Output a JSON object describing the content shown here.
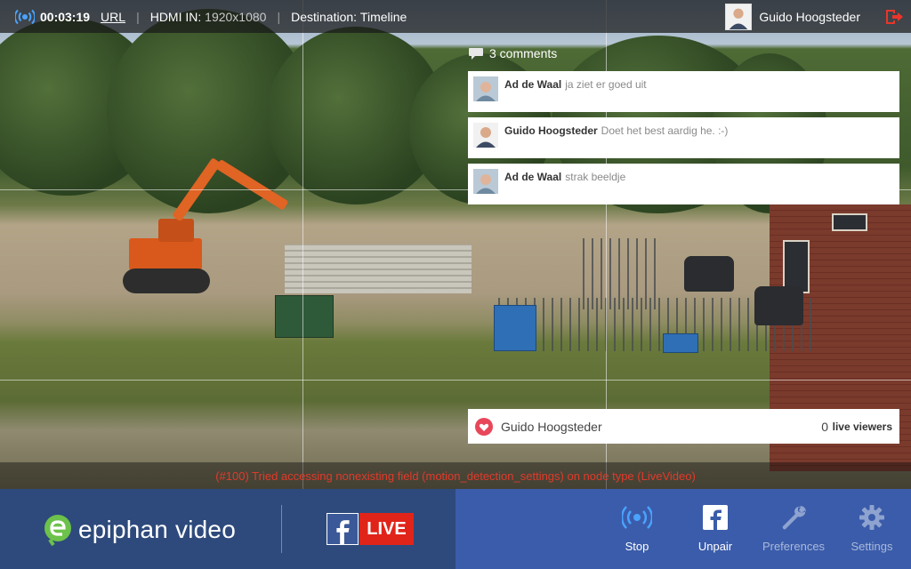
{
  "topbar": {
    "timer": "00:03:19",
    "url_label": "URL",
    "hdmi_label": "HDMI IN:",
    "hdmi_value": "1920x1080",
    "destination_label": "Destination:",
    "destination_value": "Timeline",
    "user_name": "Guido Hoogsteder"
  },
  "comments": {
    "count_label": "3 comments",
    "items": [
      {
        "name": "Ad de Waal",
        "text": "ja ziet er goed uit"
      },
      {
        "name": "Guido Hoogsteder",
        "text": "Doet het best aardig he. :-)"
      },
      {
        "name": "Ad de Waal",
        "text": "strak beeldje"
      }
    ]
  },
  "viewers": {
    "name": "Guido Hoogsteder",
    "count": "0",
    "label": "live viewers"
  },
  "error_message": "(#100) Tried accessing nonexisting field (motion_detection_settings) on node type (LiveVideo)",
  "branding": {
    "brand_text": "epiphan video",
    "live_badge": "LIVE"
  },
  "actions": [
    {
      "label": "Stop",
      "icon": "broadcast-icon",
      "enabled": true
    },
    {
      "label": "Unpair",
      "icon": "facebook-icon",
      "enabled": true
    },
    {
      "label": "Preferences",
      "icon": "wrench-icon",
      "enabled": false
    },
    {
      "label": "Settings",
      "icon": "gear-icon",
      "enabled": false
    }
  ],
  "colors": {
    "bottom_left": "#2e4a7c",
    "bottom_right": "#3b5caa",
    "error": "#e23a2a",
    "live_red": "#e0241a",
    "accent_blue": "#4aa3ff"
  }
}
